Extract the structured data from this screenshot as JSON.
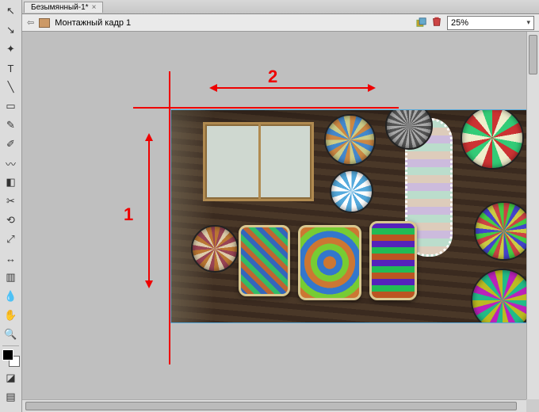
{
  "tab": {
    "title": "Безымянный-1*",
    "close": "×"
  },
  "breadcrumb": {
    "title": "Монтажный кадр 1",
    "back_arrow": "⇦"
  },
  "zoom": {
    "value": "25%"
  },
  "annotations": {
    "label_vertical": "1",
    "label_horizontal": "2"
  },
  "tools": [
    {
      "name": "move-tool",
      "glyph": "↖"
    },
    {
      "name": "direct-select-tool",
      "glyph": "↘"
    },
    {
      "name": "wand-tool",
      "glyph": "✦"
    },
    {
      "name": "type-tool",
      "glyph": "T"
    },
    {
      "name": "line-tool",
      "glyph": "╲"
    },
    {
      "name": "rect-tool",
      "glyph": "▭"
    },
    {
      "name": "brush-tool",
      "glyph": "✎"
    },
    {
      "name": "pencil-tool",
      "glyph": "✐"
    },
    {
      "name": "blob-tool",
      "glyph": "〰"
    },
    {
      "name": "eraser-tool",
      "glyph": "◧"
    },
    {
      "name": "scissors-tool",
      "glyph": "✂"
    },
    {
      "name": "rotate-tool",
      "glyph": "⟲"
    },
    {
      "name": "scale-tool",
      "glyph": "⤢"
    },
    {
      "name": "width-tool",
      "glyph": "↔"
    },
    {
      "name": "gradient-tool",
      "glyph": "▥"
    },
    {
      "name": "eyedropper-tool",
      "glyph": "💧"
    },
    {
      "name": "hand-tool",
      "glyph": "✋"
    },
    {
      "name": "zoom-tool",
      "glyph": "🔍"
    }
  ]
}
